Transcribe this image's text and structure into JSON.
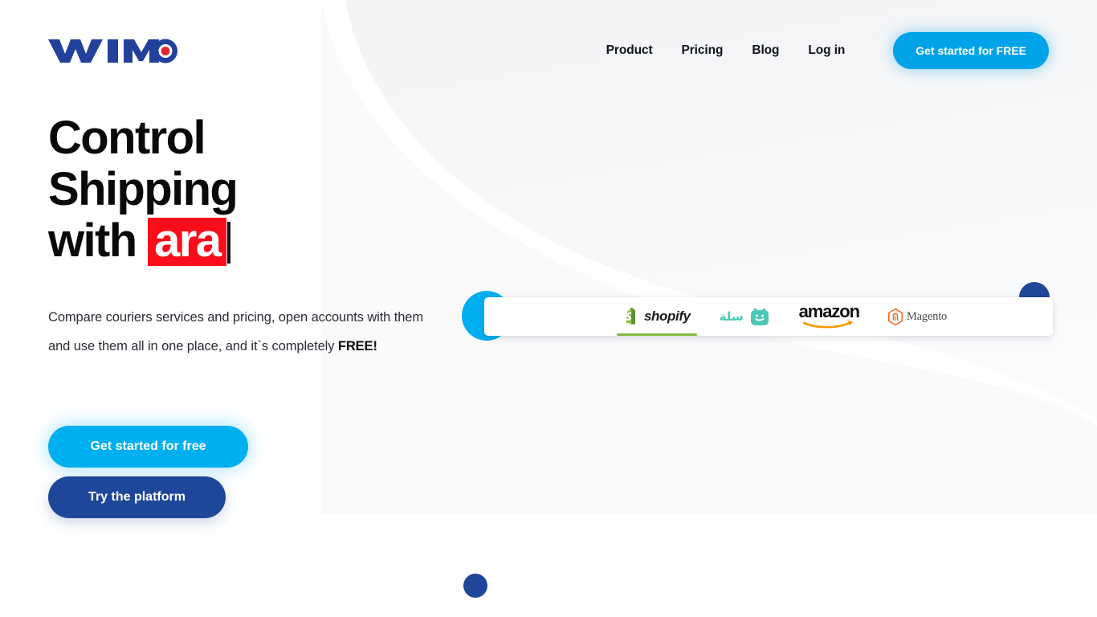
{
  "brand": {
    "name": "WIMO",
    "logo_letters": "WIMO",
    "logo_color": "#23409A",
    "logo_dot_color": "#E3242B"
  },
  "colors": {
    "accent_cyan": "#00AFEF",
    "navy": "#1F4799",
    "highlight_red": "#FC0D1B",
    "text_dark": "#0a0a0a",
    "bg_swoosh": "#F4F5F7"
  },
  "header": {
    "nav": [
      {
        "label": "Product",
        "name": "nav-product"
      },
      {
        "label": "Pricing",
        "name": "nav-pricing"
      },
      {
        "label": "Blog",
        "name": "nav-blog"
      },
      {
        "label": "Log in",
        "name": "nav-login"
      }
    ],
    "cta_label": "Get started for FREE"
  },
  "hero": {
    "headline_line1": "Control",
    "headline_line2": "Shipping",
    "headline_line3_prefix": "with",
    "headline_highlight": "ara",
    "subtitle_part1": "Compare couriers services and pricing, open accounts with them and use them all in one place, and it`s completely ",
    "subtitle_bold": "FREE!",
    "primary_button": "Get started for free",
    "secondary_button": "Try the platform"
  },
  "integrations": {
    "items": [
      {
        "name": "shopify",
        "label": "shopify",
        "active": true,
        "color": "#95BF47"
      },
      {
        "name": "salla",
        "label": "سلة",
        "active": false,
        "color": "#4CC8B6"
      },
      {
        "name": "amazon",
        "label": "amazon",
        "active": false,
        "color": "#FF9900"
      },
      {
        "name": "magento",
        "label": "Magento",
        "active": false,
        "color": "#F26322"
      }
    ]
  }
}
